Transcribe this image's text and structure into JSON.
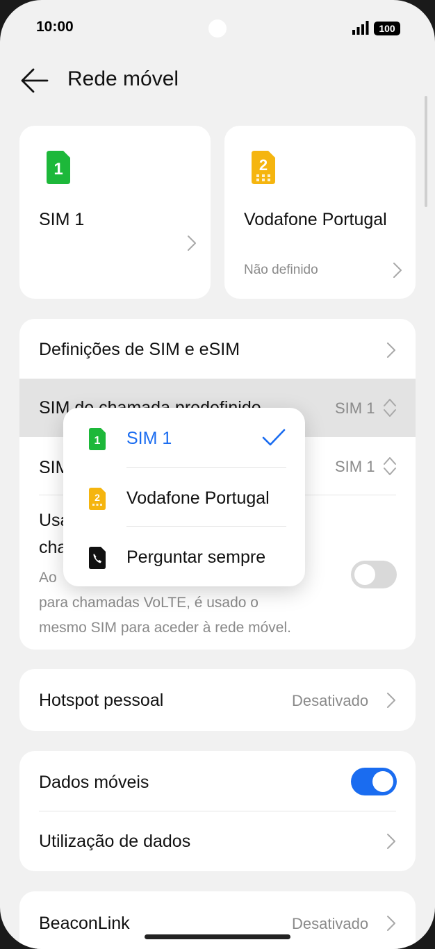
{
  "status_bar": {
    "time": "10:00",
    "battery": "100"
  },
  "header": {
    "title": "Rede móvel"
  },
  "sim_cards": [
    {
      "badge": "1",
      "name": "SIM 1",
      "subtitle": "",
      "color": "#1db83a"
    },
    {
      "badge": "2",
      "name": "Vodafone Portugal",
      "subtitle": "Não definido",
      "color": "#f5b50f"
    }
  ],
  "group1": {
    "sim_settings_label": "Definições de SIM e eSIM",
    "default_call_sim_label": "SIM de chamada predefinido",
    "default_call_sim_value": "SIM 1",
    "default_data_sim_label": "SIM",
    "default_data_sim_value": "SIM 1",
    "volte_label_line1": "Usa",
    "volte_label_line2": "cha",
    "volte_desc_line1": "Ao",
    "volte_desc_line2": "para chamadas VoLTE, é usado o",
    "volte_desc_line3": "mesmo SIM para aceder à rede móvel.",
    "volte_toggle": false
  },
  "hotspot": {
    "label": "Hotspot pessoal",
    "value": "Desativado"
  },
  "data_group": {
    "mobile_data_label": "Dados móveis",
    "mobile_data_toggle": true,
    "data_usage_label": "Utilização de dados"
  },
  "beaconlink": {
    "label": "BeaconLink",
    "value": "Desativado"
  },
  "popup": {
    "options": [
      {
        "label": "SIM 1",
        "selected": true,
        "icon": "sim-1-icon"
      },
      {
        "label": "Vodafone Portugal",
        "selected": false,
        "icon": "sim-2-icon"
      },
      {
        "label": "Perguntar sempre",
        "selected": false,
        "icon": "phone-icon"
      }
    ]
  },
  "colors": {
    "accent": "#1a6cf0",
    "sim1": "#1db83a",
    "sim2": "#f5b50f"
  }
}
